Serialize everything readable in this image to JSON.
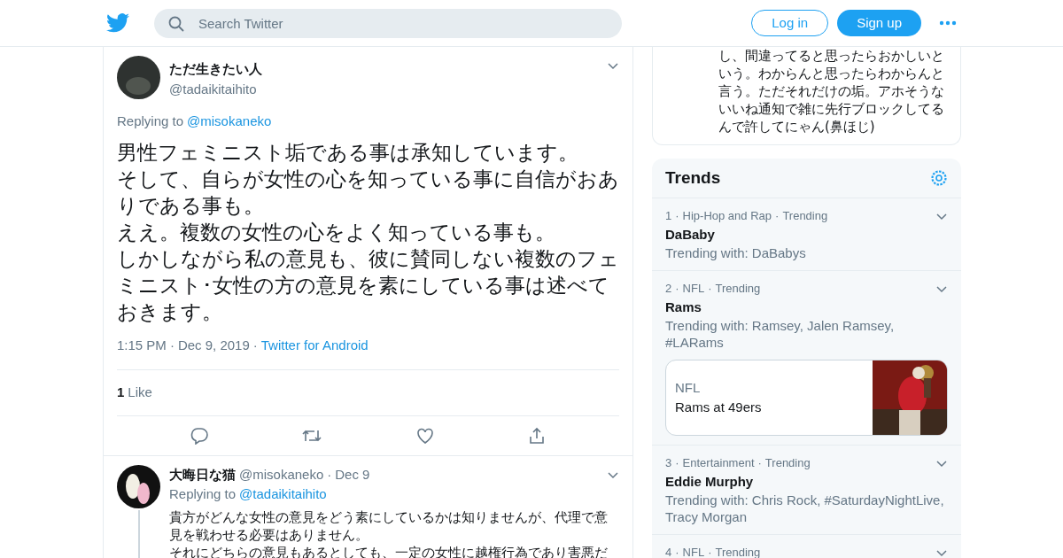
{
  "header": {
    "search_placeholder": "Search Twitter",
    "login": "Log in",
    "signup": "Sign up"
  },
  "tweet": {
    "name": "ただ生きたい人",
    "handle": "@tadaikitaihito",
    "replying_label": "Replying to",
    "replying_to": "@misokaneko",
    "lines": [
      "男性フェミニスト垢である事は承知しています。",
      "そして、自らが女性の心を知っている事に自信がおありである事も。",
      "ええ。複数の女性の心をよく知っている事も。",
      "しかしながら私の意見も、彼に賛同しない複数のフェミニスト･女性の方の意見を素にしている事は述べておきます。"
    ],
    "time": "1:15 PM",
    "sep1": "·",
    "date": "Dec 9, 2019",
    "sep2": "·",
    "source": "Twitter for Android",
    "like_count": "1",
    "like_label": "Like"
  },
  "reply": {
    "name": "大晦日な猫",
    "handle": "@misokaneko",
    "sep": "·",
    "date": "Dec 9",
    "replying_label": "Replying to",
    "replying_to": "@tadaikitaihito",
    "lines": [
      "貴方がどんな女性の意見をどう素にしているかは知りませんが、代理で意見を戦わせる必要はありません。",
      "それにどちらの意見もあるとしても、一定の女性に越権行為であり害悪だ"
    ]
  },
  "side_card": {
    "lines": [
      "し、間違ってると思ったらおかしいという。わからんと思ったらわからんと言う。ただそれだけの垢。アホそうないいね通知で雑に先行ブロックしてるんで許してにゃん(鼻ほじ)"
    ]
  },
  "trends": {
    "title": "Trends",
    "items": [
      {
        "kind": "trend",
        "rank": "1",
        "sep1": "·",
        "category": "Hip-Hop and Rap",
        "sep2": "·",
        "status": "Trending",
        "name": "DaBaby",
        "with": "Trending with: DaBabys"
      },
      {
        "kind": "trend",
        "rank": "2",
        "sep1": "·",
        "category": "NFL",
        "sep2": "·",
        "status": "Trending",
        "name": "Rams",
        "with": "Trending with: Ramsey, Jalen Ramsey, #LARams",
        "card": {
          "label": "NFL",
          "title": "Rams at 49ers",
          "kind": "picture"
        }
      },
      {
        "kind": "trend",
        "rank": "3",
        "sep1": "·",
        "category": "Entertainment",
        "sep2": "·",
        "status": "Trending",
        "name": "Eddie Murphy",
        "with": "Trending with: Chris Rock, #SaturdayNightLive, Tracy Morgan"
      },
      {
        "kind": "trend",
        "rank": "4",
        "sep1": "·",
        "category": "NFL",
        "sep2": "·",
        "status": "Trending"
      }
    ]
  }
}
